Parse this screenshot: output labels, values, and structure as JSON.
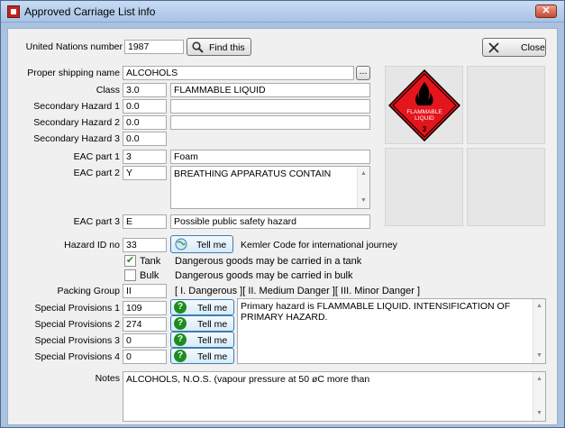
{
  "window": {
    "title": "Approved Carriage List info",
    "close_glyph": "✕"
  },
  "un": {
    "label": "United Nations number",
    "value": "1987",
    "find_label": "Find this"
  },
  "close_button": {
    "label": "Close"
  },
  "shipping": {
    "label": "Proper shipping name",
    "value": "ALCOHOLS",
    "browse_label": "..."
  },
  "class": {
    "label": "Class",
    "value": "3.0",
    "desc": "FLAMMABLE LIQUID"
  },
  "sec1": {
    "label": "Secondary Hazard 1",
    "value": "0.0",
    "desc": ""
  },
  "sec2": {
    "label": "Secondary Hazard 2",
    "value": "0.0",
    "desc": ""
  },
  "sec3": {
    "label": "Secondary Hazard 3",
    "value": "0.0"
  },
  "eac1": {
    "label": "EAC part 1",
    "value": "3",
    "desc": "Foam"
  },
  "eac2": {
    "label": "EAC part 2",
    "value": "Y",
    "desc": "BREATHING APPARATUS CONTAIN"
  },
  "eac3": {
    "label": "EAC part 3",
    "value": "E",
    "desc": "Possible public safety hazard"
  },
  "hazard_id": {
    "label": "Hazard ID no",
    "value": "33",
    "tell_label": "Tell me",
    "info": "Kemler Code for international journey"
  },
  "tank": {
    "label": "Tank",
    "checked": true,
    "desc": "Dangerous goods may be carried in a tank"
  },
  "bulk": {
    "label": "Bulk",
    "checked": false,
    "desc": "Dangerous goods may be carried in bulk"
  },
  "packing": {
    "label": "Packing Group",
    "value": "II",
    "legend": "[ I. Dangerous ][ II. Medium Danger ][ III. Minor Danger ]"
  },
  "sp": [
    {
      "label": "Special Provisions 1",
      "value": "109",
      "tell_label": "Tell me"
    },
    {
      "label": "Special Provisions 2",
      "value": "274",
      "tell_label": "Tell me"
    },
    {
      "label": "Special Provisions 3",
      "value": "0",
      "tell_label": "Tell me"
    },
    {
      "label": "Special Provisions 4",
      "value": "0",
      "tell_label": "Tell me"
    }
  ],
  "sp_text": "Primary hazard is FLAMMABLE LIQUID. INTENSIFICATION OF PRIMARY HAZARD.",
  "notes": {
    "label": "Notes",
    "value": "ALCOHOLS, N.O.S. (vapour pressure at 50 øC more than"
  },
  "placard": {
    "line1": "FLAMMABLE",
    "line2": "LIQUID",
    "number": "3"
  },
  "colors": {
    "placard_red": "#e4151c",
    "title_bg": "#b7cfed"
  }
}
